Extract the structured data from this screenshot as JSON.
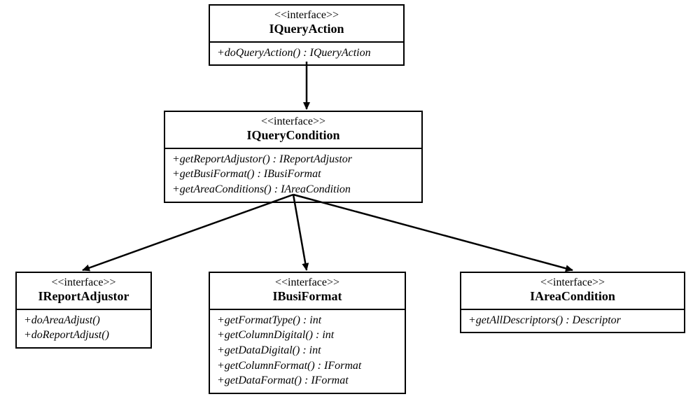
{
  "boxes": {
    "iQueryAction": {
      "stereotype": "<<interface>>",
      "name": "IQueryAction",
      "methods": [
        "+doQueryAction() : IQueryAction"
      ]
    },
    "iQueryCondition": {
      "stereotype": "<<interface>>",
      "name": "IQueryCondition",
      "methods": [
        "+getReportAdjustor() : IReportAdjustor",
        "+getBusiFormat() : IBusiFormat",
        "+getAreaConditions() : IAreaCondition"
      ]
    },
    "iReportAdjustor": {
      "stereotype": "<<interface>>",
      "name": "IReportAdjustor",
      "methods": [
        "+doAreaAdjust()",
        "+doReportAdjust()"
      ]
    },
    "iBusiFormat": {
      "stereotype": "<<interface>>",
      "name": "IBusiFormat",
      "methods": [
        "+getFormatType() : int",
        "+getColumnDigital() : int",
        "+getDataDigital() : int",
        "+getColumnFormat() : IFormat",
        "+getDataFormat() : IFormat"
      ]
    },
    "iAreaCondition": {
      "stereotype": "<<interface>>",
      "name": "IAreaCondition",
      "methods": [
        "+getAllDescriptors() : Descriptor"
      ]
    }
  }
}
